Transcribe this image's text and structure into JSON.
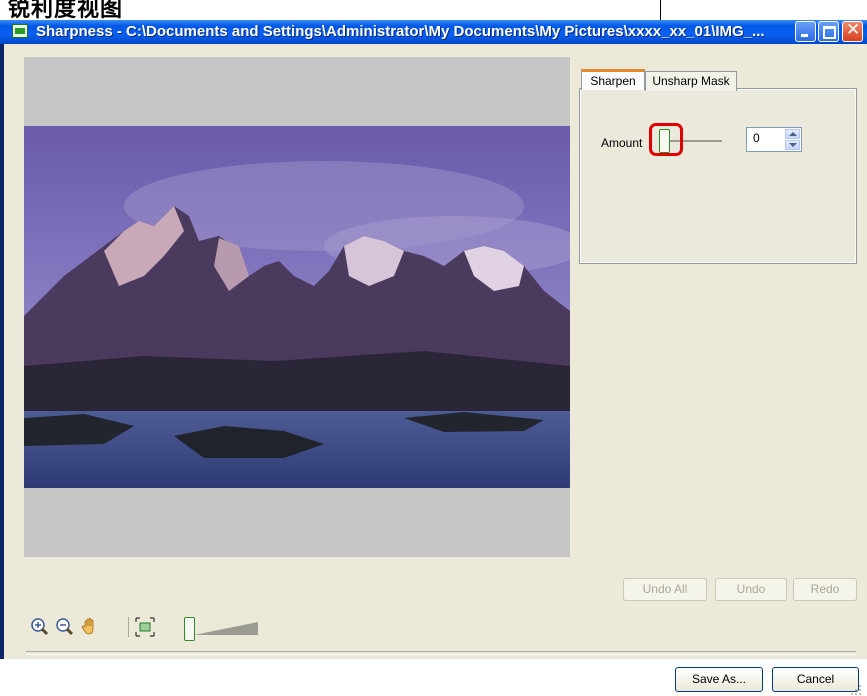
{
  "caption": {
    "text": "锐利度视图"
  },
  "window": {
    "title": "Sharpness - C:\\Documents and Settings\\Administrator\\My Documents\\My Pictures\\xxxx_xx_01\\IMG_...",
    "min_label": "",
    "max_label": "",
    "close_label": "✕"
  },
  "tabs": [
    {
      "label": "Sharpen",
      "selected": true
    },
    {
      "label": "Unsharp Mask",
      "selected": false
    }
  ],
  "sharpen": {
    "amount_label": "Amount",
    "amount_value": "0",
    "slider_fraction": 0
  },
  "history_buttons": {
    "undo_all": "Undo All",
    "undo": "Undo",
    "redo": "Redo"
  },
  "footer": {
    "save_as": "Save As...",
    "cancel": "Cancel"
  },
  "toolbar": {
    "icons": [
      "zoom-in-icon",
      "zoom-out-icon",
      "hand-icon",
      "fit-to-window-icon"
    ],
    "zoom_slider_fraction": 0
  },
  "colors": {
    "titlebar": "#0058e6",
    "dialog_bg": "#ece9d8",
    "preview_bg": "#c6c6c6",
    "highlight": "#e00000"
  }
}
